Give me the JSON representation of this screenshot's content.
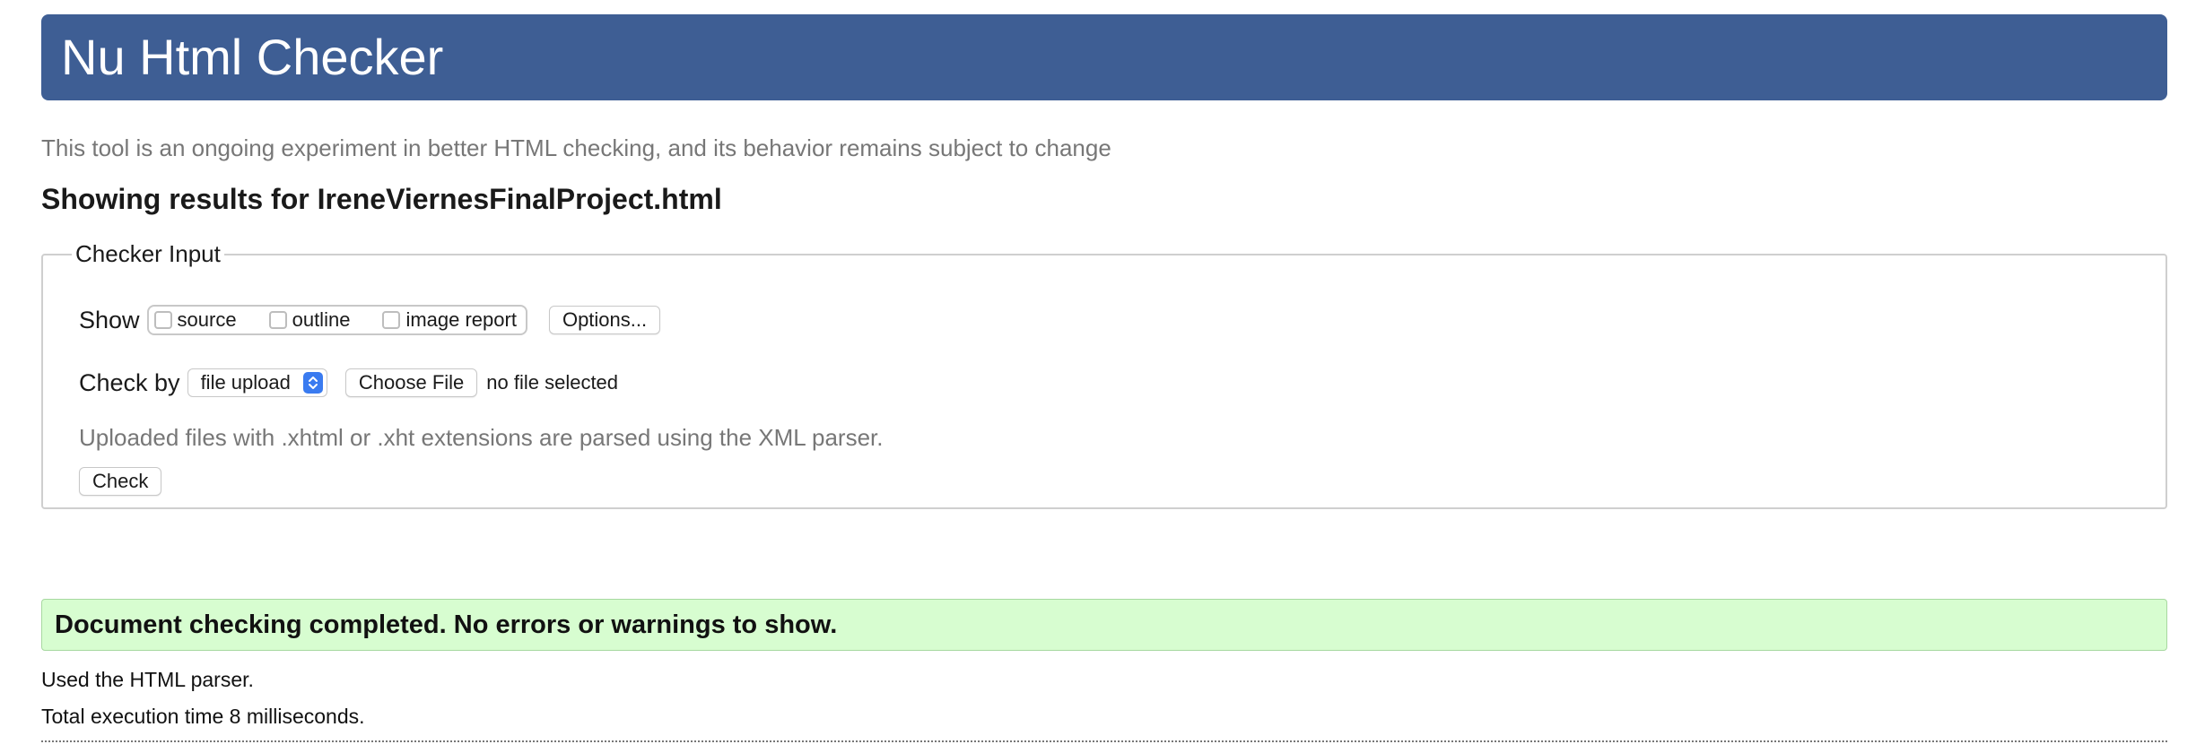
{
  "header": {
    "title": "Nu Html Checker",
    "bg_color": "#3e5e94"
  },
  "tagline": "This tool is an ongoing experiment in better HTML checking, and its behavior remains subject to change",
  "results_heading": "Showing results for IreneViernesFinalProject.html",
  "checker_input": {
    "legend": "Checker Input",
    "show_label": "Show",
    "checkboxes": [
      {
        "label": "source",
        "checked": false
      },
      {
        "label": "outline",
        "checked": false
      },
      {
        "label": "image report",
        "checked": false
      }
    ],
    "options_button": "Options...",
    "check_by_label": "Check by",
    "check_by_selected": "file upload",
    "choose_file_button": "Choose File",
    "no_file_text": "no file selected",
    "xml_note": "Uploaded files with .xhtml or .xht extensions are parsed using the XML parser.",
    "check_button": "Check"
  },
  "result": {
    "success_message": "Document checking completed. No errors or warnings to show.",
    "success_bg": "#d7fdd0",
    "parser_info": "Used the HTML parser.",
    "execution_time": "Total execution time 8 milliseconds."
  }
}
